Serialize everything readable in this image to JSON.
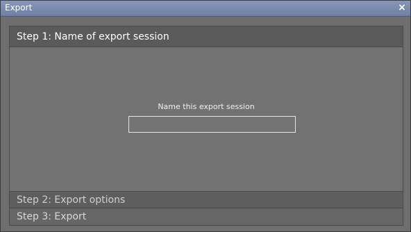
{
  "window": {
    "title": "Export",
    "close_glyph": "×"
  },
  "steps": [
    {
      "label": "Step 1: Name of export session",
      "expanded": true
    },
    {
      "label": "Step 2: Export options",
      "expanded": false
    },
    {
      "label": "Step 3: Export",
      "expanded": false
    }
  ],
  "step1": {
    "field_label": "Name this export session",
    "input_value": "",
    "input_placeholder": ""
  },
  "colors": {
    "titlebar": "#7a8bb0",
    "panel_bg": "#727272",
    "header_bg": "#5a5a5a",
    "input_border": "#e6e6e6"
  },
  "icons": {
    "close": "close-icon"
  }
}
